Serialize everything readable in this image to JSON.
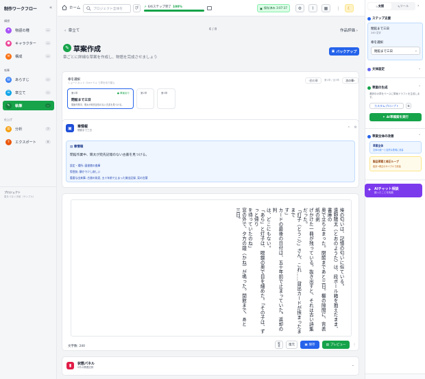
{
  "sidebar": {
    "app_title": "制作ワークフロー",
    "sections": [
      {
        "label": "構想",
        "items": [
          {
            "label": "物語の種",
            "badge": "—",
            "color": "#a855f7",
            "active": false
          },
          {
            "label": "キャラクター",
            "badge": "—",
            "color": "#ec4899",
            "active": false
          },
          {
            "label": "構成",
            "badge": "—",
            "color": "#f97316",
            "active": false
          }
        ]
      },
      {
        "label": "執筆",
        "items": [
          {
            "label": "あらすじ",
            "badge": "—",
            "color": "#3b82f6",
            "active": false
          },
          {
            "label": "章立て",
            "badge": "—",
            "color": "#0ea5e9",
            "active": false
          },
          {
            "label": "執筆",
            "badge": "—",
            "color": "#16a34a",
            "active": true
          }
        ]
      },
      {
        "label": "仕上げ",
        "items": [
          {
            "label": "分析",
            "badge": "7",
            "color": "#f59e0b",
            "active": false
          },
          {
            "label": "エクスポート",
            "badge": "8",
            "color": "#ea580c",
            "active": false
          }
        ]
      }
    ],
    "project_label": "プロジェクト",
    "project_name": "星をつなぐ手紙（サンプル）"
  },
  "topbar": {
    "home_label": "ホーム",
    "search_placeholder": "プロジェクト全体を",
    "progress_label": "6/6ステップ完了",
    "progress_pct": "100%",
    "progress_value": 1.0,
    "saved_label": "保存済み 3:07:37"
  },
  "main": {
    "nav_prev": "章立て",
    "nav_count": "6 / 8",
    "nav_next": "作品評価",
    "section_title": "草案作成",
    "section_desc": "章ごとに詳細な草案を作成し、物語を完成させましょう",
    "backup_label": "バックアップ",
    "scene_select": {
      "label": "章を選択",
      "hint": "ショートカット: Ctrl+↑/↓ で章を切り替え",
      "prev_label": "前の章",
      "position": "第1章 / 全3章",
      "next_label": "次の章",
      "cards": [
        {
          "no": "第1章",
          "status": "草案あり",
          "title": "閉館まで三日",
          "desc": "閉館作業中、陽太が宛先記憶のない古書を見つける。",
          "selected": true
        },
        {
          "no": "第2章",
          "status": "",
          "title": "",
          "desc": "",
          "selected": false
        },
        {
          "no": "第3章",
          "status": "",
          "title": "",
          "desc": "",
          "selected": false
        }
      ]
    },
    "chapter_info": {
      "title": "章情報",
      "subtitle": "閉館まで三日",
      "box_title": "章情報",
      "summary": "閉館作業中、陽太が宛先記憶のない古書を見つける。",
      "lines": [
        "設定・場所: 図書館の書庫",
        "雰囲気: 静かで少し寂しい",
        "重要な出来事: 古書の発見, 五十年前で止まった貸出記録, 栞の言葉"
      ]
    },
    "editor": {
      "text": "埃の匂いは、記憶の匂いに似ている。\n遠野陽太（とおのようた）は、段ボール箱を抱えたまま、書庫の\n奥で立ち止まった。閉館まであと三日。棚の隙間に、背表紙の剥\nげかけた一冊が残っている。抜き出すと、それは古い詩集だった。\n「灯子（とうこ）」さん、これ……貸出カードが挟まったままで\nす」\nカードの最後の日付は、五十年前で止まっていた。返却の判\nは、どこにもない。\n「あら」と灯子は、眼鏡の奥で目を細めた。「その子は、ずっと帰り\nを待っていたのね」\n窓の外で、夕方の鐘（かね）が鳴った。閉館まで、あと\n三日。",
      "char_count": "文字数: 240",
      "vertical_btn": "縦\n書",
      "undo_label": "復元",
      "save_label": "保存",
      "preview_label": "プレビュー"
    },
    "history": {
      "title": "状態パネル",
      "subtitle": "0件の関連記録"
    }
  },
  "rpanel": {
    "tabs": [
      {
        "label": "支援",
        "active": true
      },
      {
        "label": "ツール",
        "active": false
      }
    ],
    "step_support": {
      "title": "ステップ支援",
      "chapter_title": "閉館まで三日",
      "chapter_chars": "240 文字",
      "select_label": "章を選択",
      "select_value": "閉館まで三日"
    },
    "style_settings": {
      "title": "文体設定"
    },
    "draft_gen": {
      "title": "草案の生成",
      "desc": "選択中の章をベースに草案ドラフトを生成します。",
      "custom_prompt": "カスタムプロンプト",
      "run_label": "AI草稿案を実行"
    },
    "whole_improve": {
      "title": "草案全体の改善",
      "item1_title": "草案全体",
      "item1_desc": "文体の統一と自然な表現に改善",
      "item2_title": "製品草案と修正ループ",
      "item2_desc": "批評→修正のサイクルで改善"
    },
    "ai_chat": {
      "title": "AIチャット相談",
      "subtitle": "困ったことを相談"
    }
  },
  "colors": {
    "accent": "#16a34a",
    "primary": "#2563eb",
    "ai": "#7c3aed"
  }
}
